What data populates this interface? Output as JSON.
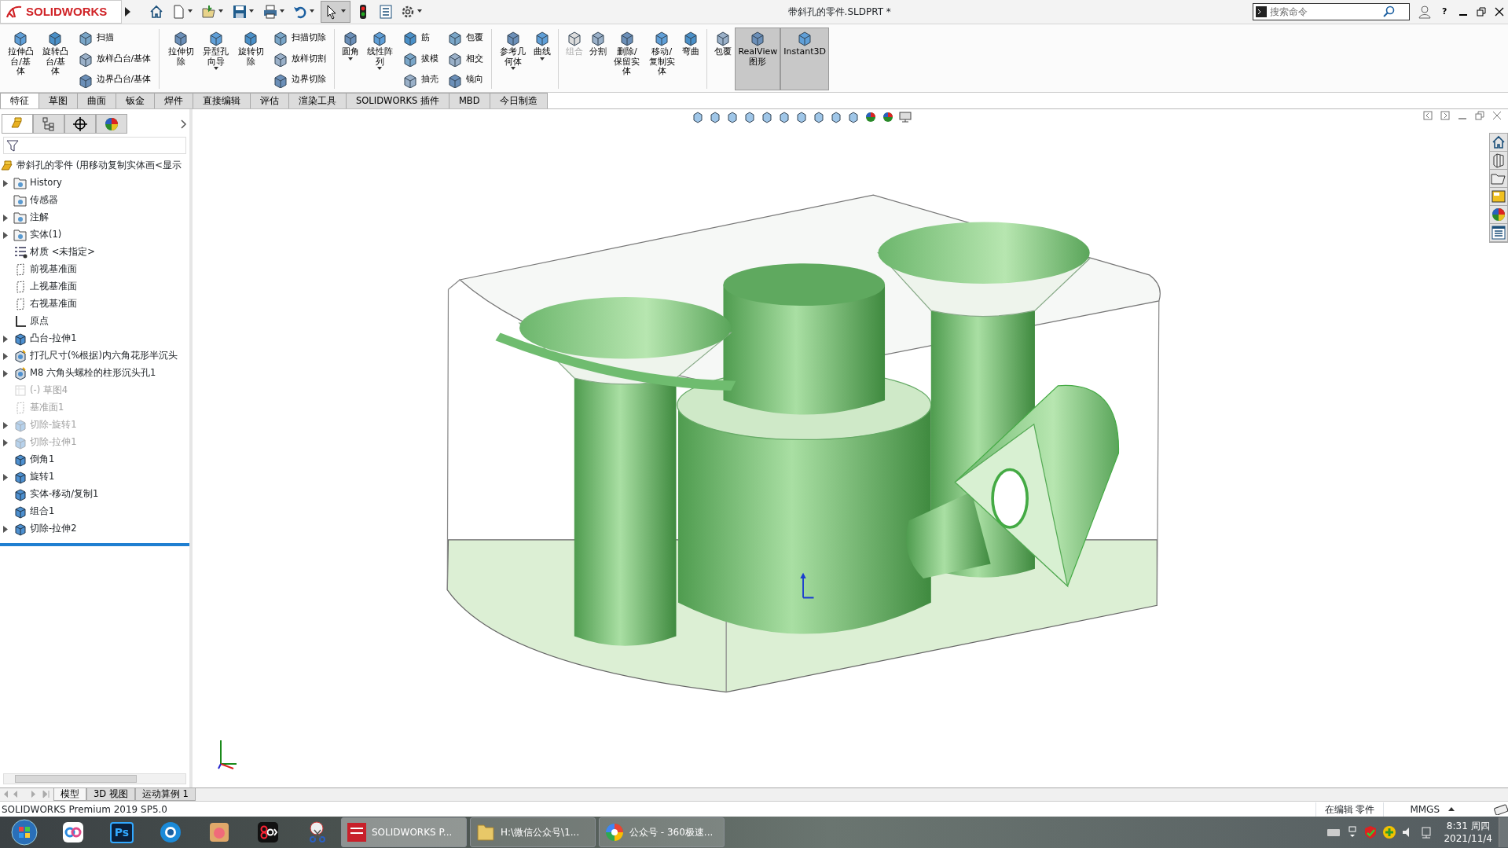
{
  "app": {
    "logo": "SOLIDWORKS"
  },
  "window": {
    "title": "带斜孔的零件.SLDPRT *"
  },
  "search": {
    "placeholder": "搜索命令"
  },
  "help_glyph": "?",
  "ribbon": [
    {
      "kind": "large",
      "label": "拉伸凸台/基体",
      "dropdown": false,
      "disabled": false,
      "selected": false
    },
    {
      "kind": "large",
      "label": "旋转凸台/基体",
      "dropdown": false,
      "disabled": false,
      "selected": false
    },
    {
      "kind": "stack",
      "items": [
        "扫描",
        "放样凸台/基体",
        "边界凸台/基体"
      ]
    },
    {
      "kind": "separator"
    },
    {
      "kind": "large",
      "label": "拉伸切除",
      "dropdown": false,
      "disabled": false,
      "selected": false
    },
    {
      "kind": "large",
      "label": "异型孔向导",
      "dropdown": true,
      "disabled": false,
      "selected": false
    },
    {
      "kind": "large",
      "label": "旋转切除",
      "dropdown": false,
      "disabled": false,
      "selected": false
    },
    {
      "kind": "stack",
      "items": [
        "扫描切除",
        "放样切割",
        "边界切除"
      ]
    },
    {
      "kind": "separator"
    },
    {
      "kind": "large",
      "label": "圆角",
      "dropdown": true,
      "disabled": false,
      "selected": false
    },
    {
      "kind": "large",
      "label": "线性阵列",
      "dropdown": true,
      "disabled": false,
      "selected": false
    },
    {
      "kind": "stack",
      "items": [
        "筋",
        "拔模",
        "抽壳"
      ]
    },
    {
      "kind": "stack",
      "items": [
        "包覆",
        "相交",
        "镜向"
      ]
    },
    {
      "kind": "separator"
    },
    {
      "kind": "large",
      "label": "参考几何体",
      "dropdown": true,
      "disabled": false,
      "selected": false
    },
    {
      "kind": "large",
      "label": "曲线",
      "dropdown": true,
      "disabled": false,
      "selected": false
    },
    {
      "kind": "separator"
    },
    {
      "kind": "large",
      "label": "组合",
      "dropdown": false,
      "disabled": true,
      "selected": false
    },
    {
      "kind": "large",
      "label": "分割",
      "dropdown": false,
      "disabled": false,
      "selected": false
    },
    {
      "kind": "large",
      "label": "删除/保留实体",
      "dropdown": false,
      "disabled": false,
      "selected": false
    },
    {
      "kind": "large",
      "label": "移动/复制实体",
      "dropdown": false,
      "disabled": false,
      "selected": false
    },
    {
      "kind": "large",
      "label": "弯曲",
      "dropdown": false,
      "disabled": false,
      "selected": false
    },
    {
      "kind": "separator"
    },
    {
      "kind": "large",
      "label": "包覆",
      "dropdown": false,
      "disabled": false,
      "selected": false
    },
    {
      "kind": "large",
      "label": "RealView 图形",
      "dropdown": false,
      "disabled": false,
      "selected": true
    },
    {
      "kind": "large",
      "label": "Instant3D",
      "dropdown": false,
      "disabled": false,
      "selected": true
    }
  ],
  "tabs": [
    {
      "label": "特征",
      "selected": true
    },
    {
      "label": "草图",
      "selected": false
    },
    {
      "label": "曲面",
      "selected": false
    },
    {
      "label": "钣金",
      "selected": false
    },
    {
      "label": "焊件",
      "selected": false
    },
    {
      "label": "直接编辑",
      "selected": false
    },
    {
      "label": "评估",
      "selected": false
    },
    {
      "label": "渲染工具",
      "selected": false
    },
    {
      "label": "SOLIDWORKS 插件",
      "selected": false
    },
    {
      "label": "MBD",
      "selected": false
    },
    {
      "label": "今日制造",
      "selected": false
    }
  ],
  "panel_tabs": [
    {
      "kind": "features",
      "selected": true
    },
    {
      "kind": "properties",
      "selected": false
    },
    {
      "kind": "configurations",
      "selected": false
    },
    {
      "kind": "appearance",
      "selected": false
    }
  ],
  "feature_tree": {
    "root": "带斜孔的零件  (用移动复制实体画<显示",
    "items": [
      {
        "kind": "folder",
        "label": "History",
        "expandable": true,
        "suppressed": false
      },
      {
        "kind": "folder",
        "label": "传感器",
        "expandable": false,
        "suppressed": false
      },
      {
        "kind": "folder",
        "label": "注解",
        "expandable": true,
        "suppressed": false
      },
      {
        "kind": "folder",
        "label": "实体(1)",
        "expandable": true,
        "suppressed": false
      },
      {
        "kind": "material",
        "label": "材质 <未指定>",
        "expandable": false,
        "suppressed": false
      },
      {
        "kind": "plane",
        "label": "前视基准面",
        "expandable": false,
        "suppressed": false
      },
      {
        "kind": "plane",
        "label": "上视基准面",
        "expandable": false,
        "suppressed": false
      },
      {
        "kind": "plane",
        "label": "右视基准面",
        "expandable": false,
        "suppressed": false
      },
      {
        "kind": "origin",
        "label": "原点",
        "expandable": false,
        "suppressed": false
      },
      {
        "kind": "feature",
        "label": "凸台-拉伸1",
        "expandable": true,
        "suppressed": false
      },
      {
        "kind": "hole",
        "label": "打孔尺寸(%根据)内六角花形半沉头",
        "expandable": true,
        "suppressed": false
      },
      {
        "kind": "hole",
        "label": "M8 六角头螺栓的柱形沉头孔1",
        "expandable": true,
        "suppressed": false
      },
      {
        "kind": "sketch",
        "label": "(-) 草图4",
        "expandable": false,
        "suppressed": true
      },
      {
        "kind": "plane",
        "label": "基准面1",
        "expandable": false,
        "suppressed": true
      },
      {
        "kind": "feature",
        "label": "切除-旋转1",
        "expandable": true,
        "suppressed": true
      },
      {
        "kind": "feature",
        "label": "切除-拉伸1",
        "expandable": true,
        "suppressed": true
      },
      {
        "kind": "feature",
        "label": "倒角1",
        "expandable": false,
        "suppressed": false
      },
      {
        "kind": "feature",
        "label": "旋转1",
        "expandable": true,
        "suppressed": false
      },
      {
        "kind": "feature",
        "label": "实体-移动/复制1",
        "expandable": false,
        "suppressed": false
      },
      {
        "kind": "feature",
        "label": "组合1",
        "expandable": false,
        "suppressed": false
      },
      {
        "kind": "feature",
        "label": "切除-拉伸2",
        "expandable": true,
        "suppressed": false
      }
    ]
  },
  "bottom_tabs": [
    {
      "label": "模型",
      "selected": true
    },
    {
      "label": "3D 视图",
      "selected": false
    },
    {
      "label": "运动算例 1",
      "selected": false
    }
  ],
  "status_bar": {
    "product": "SOLIDWORKS Premium 2019 SP5.0",
    "mode": "在编辑 零件",
    "units": "MMGS"
  },
  "taskbar": {
    "pinned": [
      {
        "kind": "cloud"
      },
      {
        "kind": "ps",
        "label": "Ps"
      },
      {
        "kind": "browser"
      },
      {
        "kind": "photo"
      },
      {
        "kind": "recorder"
      },
      {
        "kind": "snip"
      }
    ],
    "tasks": [
      {
        "kind": "solidworks",
        "label": "SOLIDWORKS P...",
        "selected": true
      },
      {
        "kind": "folder",
        "label": "H:\\微信公众号\\1...",
        "selected": false
      },
      {
        "kind": "browser",
        "label": "公众号 - 360极速...",
        "selected": false
      }
    ],
    "clock": {
      "time": "8:31 周四",
      "date": "2021/11/4"
    }
  }
}
